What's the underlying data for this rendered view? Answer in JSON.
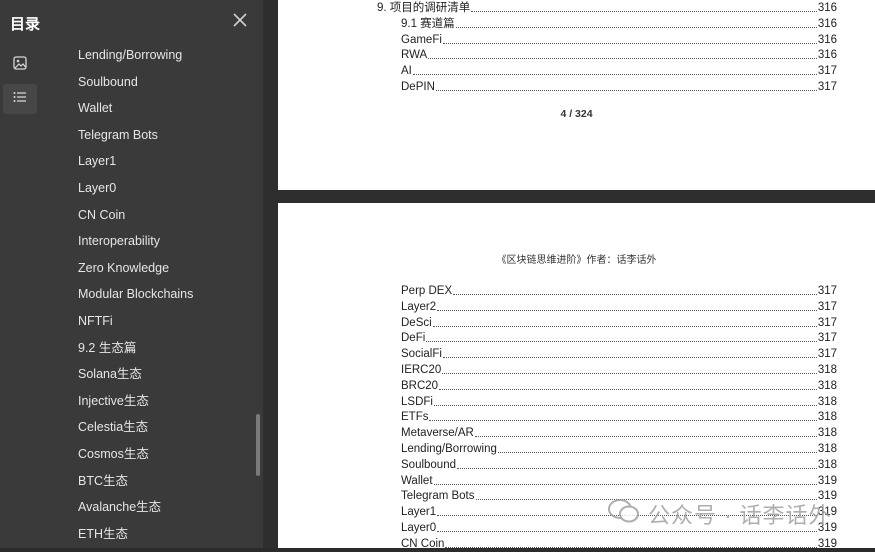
{
  "sidebar": {
    "title": "目录",
    "rail": [
      {
        "icon": "image-icon"
      },
      {
        "icon": "list-icon"
      }
    ],
    "items": [
      "Lending/Borrowing",
      "Soulbound",
      "Wallet",
      "Telegram Bots",
      "Layer1",
      "Layer0",
      "CN Coin",
      "Interoperability",
      "Zero Knowledge",
      "Modular Blockchains",
      "NFTFi",
      "9.2 生态篇",
      "Solana生态",
      "Injective生态",
      "Celestia生态",
      "Cosmos生态",
      "BTC生态",
      "Avalanche生态",
      "ETH生态"
    ]
  },
  "page1": {
    "entries": [
      {
        "title": "9. 项目的调研清单",
        "page": "316",
        "level": 0
      },
      {
        "title": "9.1 赛道篇",
        "page": "316",
        "level": 1
      },
      {
        "title": "GameFi",
        "page": "316",
        "level": 1
      },
      {
        "title": "RWA",
        "page": "316",
        "level": 1
      },
      {
        "title": "AI",
        "page": "317",
        "level": 1
      },
      {
        "title": "DePIN",
        "page": "317",
        "level": 1
      }
    ],
    "page_number": "4 / 324"
  },
  "page2": {
    "running_header": "《区块链思维进阶》作者：话李话外",
    "entries": [
      {
        "title": "Perp DEX",
        "page": "317"
      },
      {
        "title": "Layer2",
        "page": "317"
      },
      {
        "title": "DeSci",
        "page": "317"
      },
      {
        "title": "DeFi",
        "page": "317"
      },
      {
        "title": "SocialFi",
        "page": "317"
      },
      {
        "title": "IERC20",
        "page": "318"
      },
      {
        "title": "BRC20",
        "page": "318"
      },
      {
        "title": "LSDFi",
        "page": "318"
      },
      {
        "title": "ETFs",
        "page": "318"
      },
      {
        "title": "Metaverse/AR",
        "page": "318"
      },
      {
        "title": "Lending/Borrowing",
        "page": "318"
      },
      {
        "title": "Soulbound",
        "page": "318"
      },
      {
        "title": "Wallet",
        "page": "319"
      },
      {
        "title": "Telegram Bots",
        "page": "319"
      },
      {
        "title": "Layer1",
        "page": "319"
      },
      {
        "title": "Layer0",
        "page": "319"
      },
      {
        "title": "CN Coin",
        "page": "319"
      }
    ]
  },
  "watermark": "公众号 · 话李话外"
}
